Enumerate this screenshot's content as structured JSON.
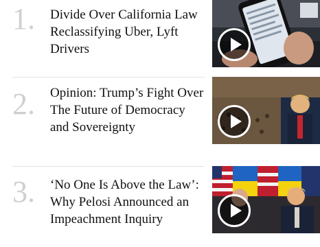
{
  "stories": [
    {
      "number": "1.",
      "headline": "Divide Over California Law Reclassifying Uber, Lyft Drivers",
      "thumbnail_icon": "phone-rideshare-thumbnail",
      "play_icon": "play-icon"
    },
    {
      "number": "2.",
      "headline": "Opinion: Trump’s Fight Over The Future of Democracy and Sovereignty",
      "thumbnail_icon": "trump-un-speech-thumbnail",
      "play_icon": "play-icon"
    },
    {
      "number": "3.",
      "headline": "‘No One Is Above the Law’: Why Pelosi Announced an Impeachment Inquiry",
      "thumbnail_icon": "trump-zelensky-meeting-thumbnail",
      "play_icon": "play-icon"
    }
  ],
  "colors": {
    "number": "#cfcfcf",
    "headline": "#111111",
    "divider": "#e2e2e2",
    "background": "#ffffff"
  }
}
